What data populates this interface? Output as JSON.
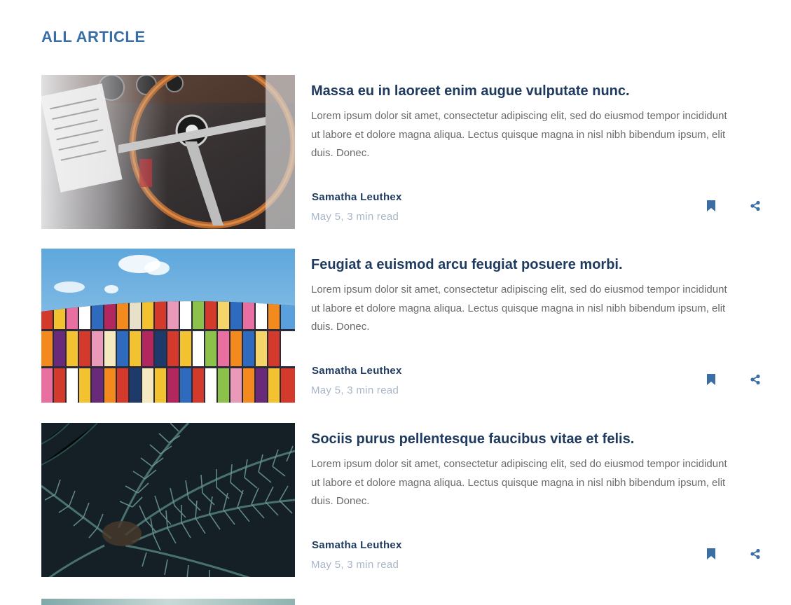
{
  "section": {
    "title": "ALL ARTICLE"
  },
  "colors": {
    "accent": "#3a6ea5",
    "title": "#1e3a5f",
    "text": "#6b6b6b",
    "muted": "#a7b6c8"
  },
  "articles": [
    {
      "image": "steering-wheel-photo",
      "title": "Massa eu in laoreet enim augue vulputate nunc.",
      "excerpt": "Lorem ipsum dolor sit amet, consectetur adipiscing elit, sed do eiusmod tempor incididunt ut labore et dolore magna aliqua. Lectus quisque magna in nisl nibh bibendum ipsum, elit duis. Donec.",
      "author": "Samatha Leuthex",
      "meta": "May 5, 3 min read",
      "bookmark_icon": "bookmark-icon",
      "share_icon": "share-icon"
    },
    {
      "image": "colorful-building-photo",
      "title": "Feugiat a euismod arcu feugiat posuere morbi.",
      "excerpt": "Lorem ipsum dolor sit amet, consectetur adipiscing elit, sed do eiusmod tempor incididunt ut labore et dolore magna aliqua. Lectus quisque magna in nisl nibh bibendum ipsum, elit duis. Donec.",
      "author": "Samatha Leuthex",
      "meta": "May 5, 3 min read",
      "bookmark_icon": "bookmark-icon",
      "share_icon": "share-icon"
    },
    {
      "image": "palm-leaves-photo",
      "title": "Sociis purus pellentesque faucibus vitae et felis.",
      "excerpt": "Lorem ipsum dolor sit amet, consectetur adipiscing elit, sed do eiusmod tempor incididunt ut labore et dolore magna aliqua. Lectus quisque magna in nisl nibh bibendum ipsum, elit duis. Donec.",
      "author": "Samatha Leuthex",
      "meta": "May 5, 3 min read",
      "bookmark_icon": "bookmark-icon",
      "share_icon": "share-icon"
    }
  ]
}
